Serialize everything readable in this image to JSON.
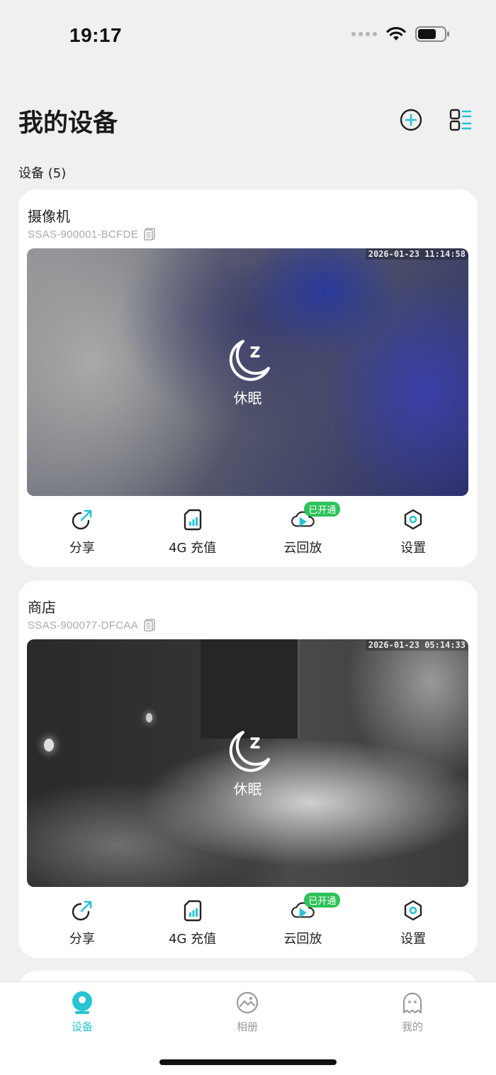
{
  "status_bar": {
    "time": "19:17"
  },
  "header": {
    "title": "我的设备"
  },
  "section": {
    "label": "设备 (5)"
  },
  "devices": [
    {
      "name": "摄像机",
      "id": "SSAS-900001-BCFDE",
      "timestamp": "2026-01-23 11:14:58",
      "status": "休眠",
      "actions": {
        "share": "分享",
        "recharge": "4G 充值",
        "cloud": "云回放",
        "cloud_badge": "已开通",
        "settings": "设置"
      }
    },
    {
      "name": "商店",
      "id": "SSAS-900077-DFCAA",
      "timestamp": "2026-01-23 05:14:33",
      "status": "休眠",
      "actions": {
        "share": "分享",
        "recharge": "4G 充值",
        "cloud": "云回放",
        "cloud_badge": "已开通",
        "settings": "设置"
      }
    }
  ],
  "tabbar": {
    "devices": "设备",
    "album": "相册",
    "mine": "我的"
  },
  "colors": {
    "accent": "#27c4d4",
    "badge": "#2ec25a"
  }
}
